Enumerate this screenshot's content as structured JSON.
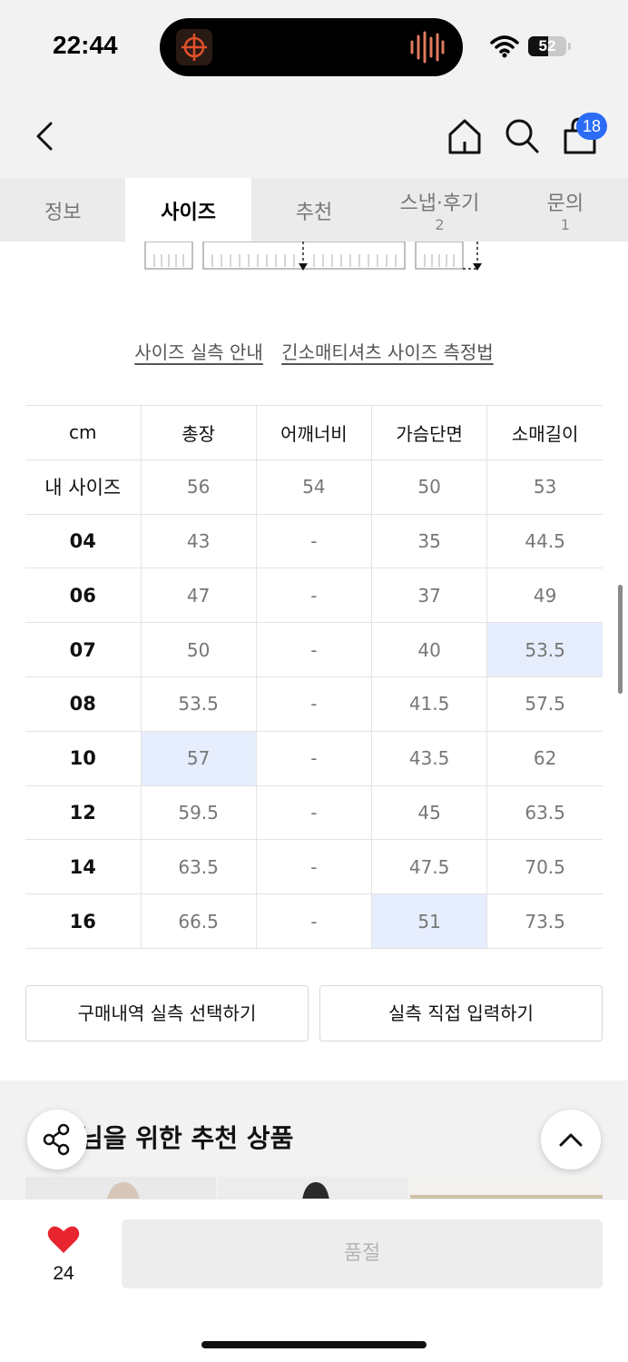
{
  "status_bar": {
    "time": "22:44",
    "battery": "52",
    "battery_level": 0.52
  },
  "header": {
    "cart_count": "18"
  },
  "tabs": [
    {
      "label": "정보",
      "count": ""
    },
    {
      "label": "사이즈",
      "count": ""
    },
    {
      "label": "추천",
      "count": ""
    },
    {
      "label": "스냅·후기",
      "count": "2"
    },
    {
      "label": "문의",
      "count": "1"
    }
  ],
  "active_tab": "사이즈",
  "guide_links": [
    "사이즈 실측 안내",
    "긴소매티셔츠 사이즈 측정법"
  ],
  "size_table": {
    "columns": [
      "cm",
      "총장",
      "어깨너비",
      "가슴단면",
      "소매길이"
    ],
    "rows": [
      [
        "내 사이즈",
        "56",
        "54",
        "50",
        "53"
      ],
      [
        "04",
        "43",
        "-",
        "35",
        "44.5"
      ],
      [
        "06",
        "47",
        "-",
        "37",
        "49"
      ],
      [
        "07",
        "50",
        "-",
        "40",
        "53.5"
      ],
      [
        "08",
        "53.5",
        "-",
        "41.5",
        "57.5"
      ],
      [
        "10",
        "57",
        "-",
        "43.5",
        "62"
      ],
      [
        "12",
        "59.5",
        "-",
        "45",
        "63.5"
      ],
      [
        "14",
        "63.5",
        "-",
        "47.5",
        "70.5"
      ],
      [
        "16",
        "66.5",
        "-",
        "51",
        "73.5"
      ]
    ],
    "highlight_color": "#e6edfc"
  },
  "buttons": {
    "purchase_history": "구매내역 실측 선택하기",
    "manual_input": "실측 직접 입력하기"
  },
  "recommendation": {
    "title": "님을 위한 추천 상품"
  },
  "bottom_bar": {
    "like_count": "24",
    "soldout_label": "품절"
  },
  "colors": {
    "accent": "#2b6cf6",
    "heart": "#e8242f"
  }
}
